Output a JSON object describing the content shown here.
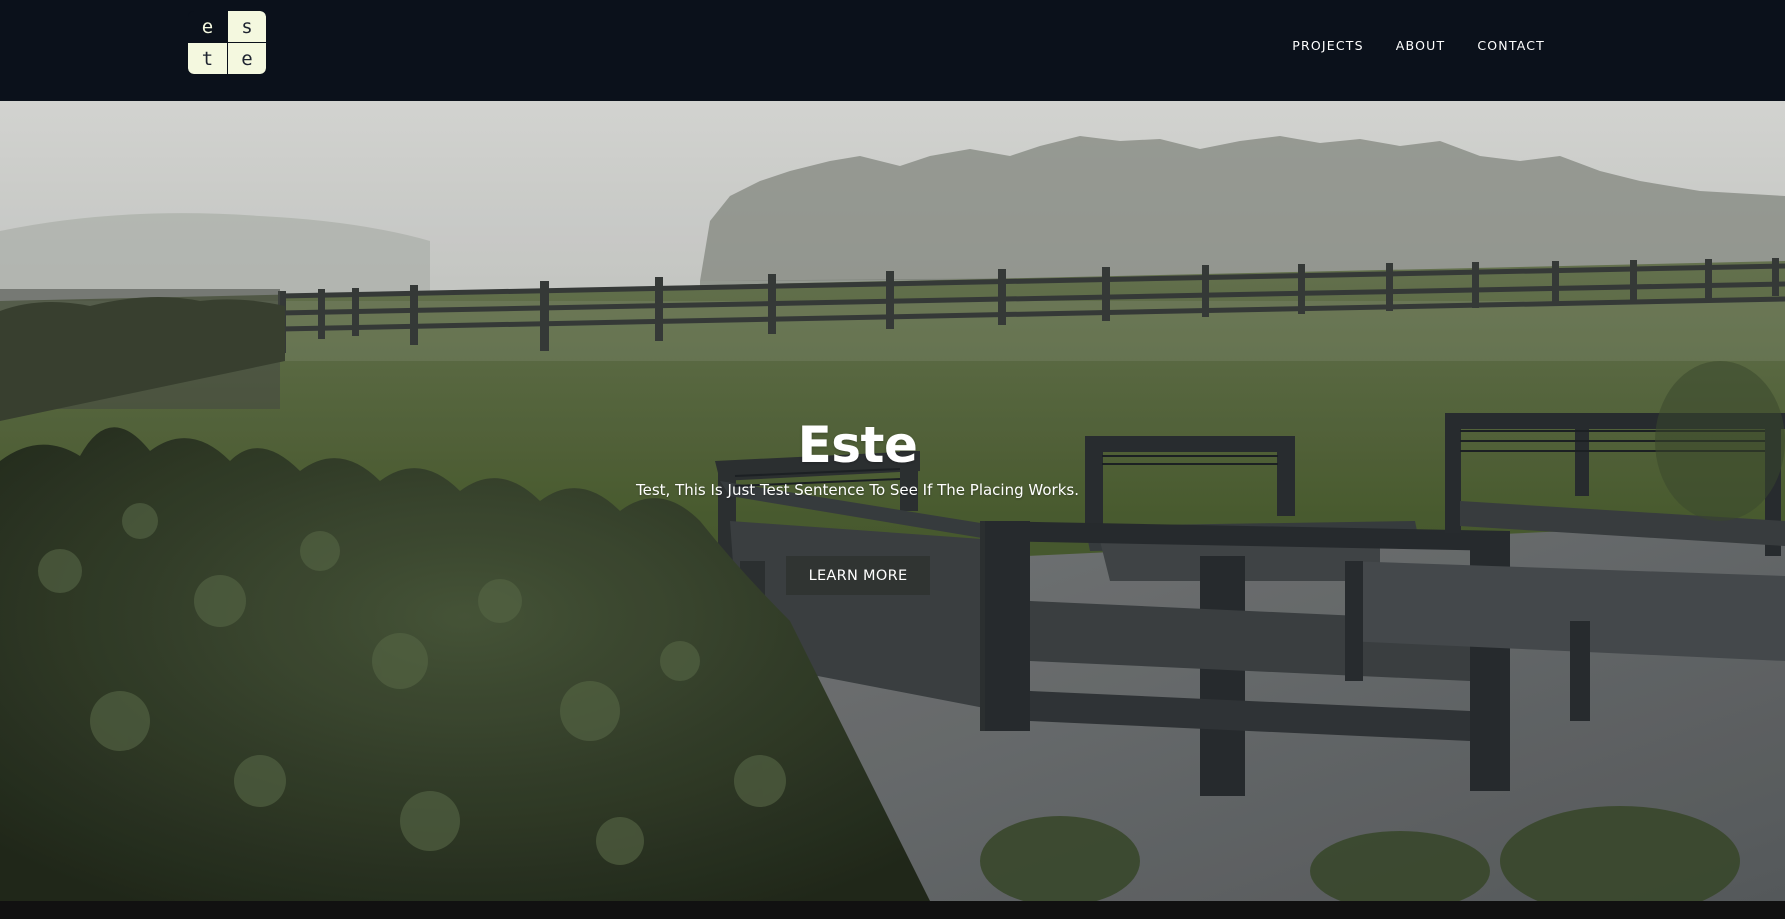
{
  "brand": {
    "logo_letters": [
      "e",
      "s",
      "t",
      "e"
    ]
  },
  "nav": {
    "items": [
      {
        "label": "PROJECTS"
      },
      {
        "label": "ABOUT"
      },
      {
        "label": "CONTACT"
      }
    ]
  },
  "hero": {
    "title": "Este",
    "subtitle": "Test, This Is Just Test Sentence To See If The Placing Works.",
    "cta_label": "LEARN MORE"
  },
  "colors": {
    "header_bg": "#0b111b",
    "logo_tile": "#f4f8df",
    "nav_text": "#ffffff"
  }
}
